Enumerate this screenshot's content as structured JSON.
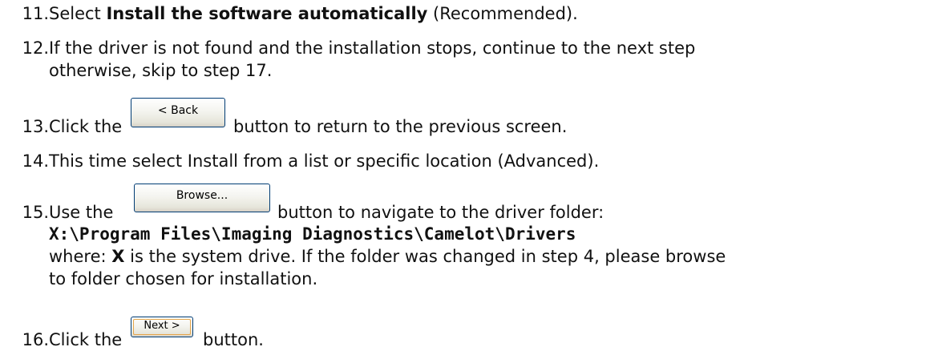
{
  "steps": [
    {
      "num": "11.",
      "pre": "Select ",
      "bold": "Install the software automatically",
      "post": " (Recommended)."
    },
    {
      "num": "12.",
      "line1": "If the driver is not found and the installation stops, continue to the next step",
      "line2": "otherwise, skip to step 17."
    },
    {
      "num": "13.",
      "pre": "Click the",
      "button": "< Back",
      "post": "button to return to the previous screen."
    },
    {
      "num": "14.",
      "text": "This time select Install from a list or specific location (Advanced)."
    },
    {
      "num": "15.",
      "pre": "Use the",
      "button": "Browse...",
      "post": "button to navigate to the driver folder:",
      "path": "X:\\Program Files\\Imaging Diagnostics\\Camelot\\Drivers",
      "where_pre": "where: ",
      "where_bold": "X",
      "where_post": " is the system drive.  If the folder was changed in step 4, please browse",
      "line_last": "to folder chosen for installation."
    },
    {
      "num": "16.",
      "pre": "Click the",
      "button": "Next >",
      "post": "button."
    }
  ]
}
